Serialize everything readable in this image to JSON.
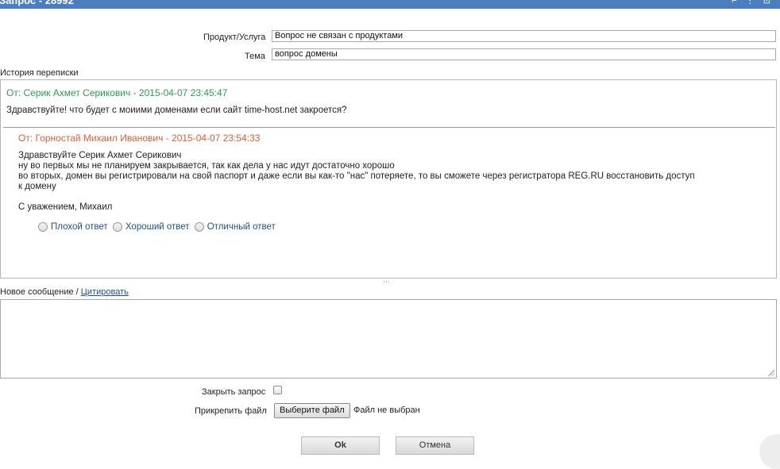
{
  "window": {
    "title": "Запрос - 28992",
    "controls": "⌐ ⋮ ⊡"
  },
  "form": {
    "product_label": "Продукт/Услуга",
    "product_value": "Вопрос не связан с продуктами",
    "subject_label": "Тема",
    "subject_value": "вопрос домены"
  },
  "history": {
    "label": "История переписки",
    "messages": [
      {
        "header": "От: Серик Ахмет Серикович - 2015-04-07 23:45:47",
        "lines": [
          "Здравствуйте! что будет с моиими доменами если сайт time-host.net закроется?"
        ]
      },
      {
        "header": "От: Горностай Михаил Иванович - 2015-04-07 23:54:33",
        "lines": [
          "Здравствуйте Серик Ахмет Серикович",
          "ну во первых мы не планируем закрывается, так как дела у нас идут достаточно хорошо",
          "во вторых, домен вы регистрировали на свой паспорт и даже если вы как-то \"нас\" потеряете, то вы сможете через регистратора REG.RU восстановить доступ",
          "к домену",
          "",
          "С уважением, Михаил"
        ]
      }
    ],
    "rating_options": [
      "Плохой ответ",
      "Хороший ответ",
      "Отличный ответ"
    ]
  },
  "new_message": {
    "label": "Новое сообщение /",
    "quote_link": "Цитировать",
    "value": ""
  },
  "close_request": {
    "label": "Закрыть запрос",
    "checked": false
  },
  "attach": {
    "label": "Прикрепить файл",
    "button": "Выберите файл",
    "status": "Файл не выбран"
  },
  "actions": {
    "ok": "Ok",
    "cancel": "Отмена"
  }
}
